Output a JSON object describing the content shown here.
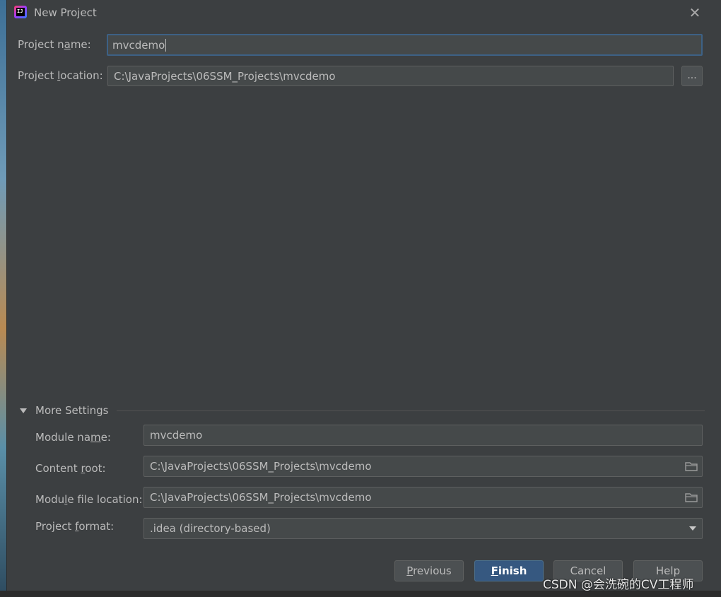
{
  "window": {
    "title": "New Project",
    "close_glyph": "✕"
  },
  "form": {
    "project_name_label_pre": "Project n",
    "project_name_label_u": "a",
    "project_name_label_post": "me:",
    "project_name_value": "mvcdemo",
    "project_location_label_pre": "Project ",
    "project_location_label_u": "l",
    "project_location_label_post": "ocation:",
    "project_location_value": "C:\\JavaProjects\\06SSM_Projects\\mvcdemo",
    "browse_label": "..."
  },
  "more_settings": {
    "header_pre": "More Setti",
    "header_u": "n",
    "header_post": "gs",
    "header_underline_char": "g",
    "module_name_label_pre": "Module na",
    "module_name_label_u": "m",
    "module_name_label_post": "e:",
    "module_name_value": "mvcdemo",
    "content_root_label_pre": "Content ",
    "content_root_label_u": "r",
    "content_root_label_post": "oot:",
    "content_root_value": "C:\\JavaProjects\\06SSM_Projects\\mvcdemo",
    "module_file_label_pre": "Modu",
    "module_file_label_u": "l",
    "module_file_label_post": "e file location:",
    "module_file_value": "C:\\JavaProjects\\06SSM_Projects\\mvcdemo",
    "project_format_label_pre": "Project ",
    "project_format_label_u": "f",
    "project_format_label_post": "ormat:",
    "project_format_value": ".idea (directory-based)"
  },
  "buttons": {
    "previous_u": "P",
    "previous_rest": "revious",
    "finish_u": "F",
    "finish_rest": "inish",
    "cancel": "Cancel",
    "help": "Help"
  },
  "watermark": "CSDN @会洗碗的CV工程师",
  "icons": {
    "app": "intellij-idea-icon",
    "close": "close-icon",
    "folder": "folder-icon",
    "expand": "triangle-down-icon",
    "dropdown": "chevron-down-icon"
  },
  "colors": {
    "dialog_bg": "#3c3f41",
    "field_bg": "#45494a",
    "focus_border": "#3d6185",
    "primary_button": "#365880"
  }
}
